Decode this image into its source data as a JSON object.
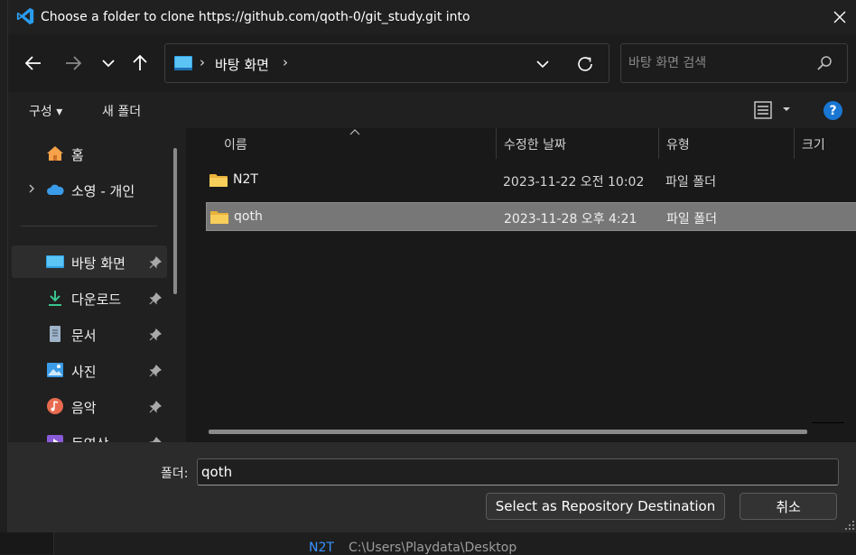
{
  "window": {
    "title": "Choose a folder to clone https://github.com/qoth-0/git_study.git into"
  },
  "nav": {
    "back_icon": "arrow-left-icon",
    "forward_icon": "arrow-right-icon",
    "recent_icon": "chevron-down-icon",
    "up_icon": "arrow-up-icon"
  },
  "address": {
    "separator": "›",
    "crumb": "바탕 화면",
    "crumb_separator": "›"
  },
  "search": {
    "placeholder": "바탕 화면 검색"
  },
  "commands": {
    "organize": "구성 ▾",
    "new_folder": "새 폴더",
    "help": "?"
  },
  "sidebar": {
    "items": [
      {
        "label": "홈",
        "icon": "home-icon",
        "pinned": false
      },
      {
        "label": "소영 - 개인",
        "icon": "onedrive-cloud-icon",
        "pinned": false,
        "expandable": true
      },
      {
        "label": "바탕 화면",
        "icon": "desktop-icon",
        "pinned": true,
        "selected": true
      },
      {
        "label": "다운로드",
        "icon": "download-icon",
        "pinned": true
      },
      {
        "label": "문서",
        "icon": "documents-icon",
        "pinned": true
      },
      {
        "label": "사진",
        "icon": "pictures-icon",
        "pinned": true
      },
      {
        "label": "음악",
        "icon": "music-icon",
        "pinned": true
      },
      {
        "label": "동영상",
        "icon": "videos-icon",
        "pinned": true
      }
    ]
  },
  "columns": {
    "name": "이름",
    "modified": "수정한 날짜",
    "type": "유형",
    "size": "크기"
  },
  "files": [
    {
      "name": "N2T",
      "modified": "2023-11-22 오전 10:02",
      "type": "파일 폴더",
      "selected": false
    },
    {
      "name": "qoth",
      "modified": "2023-11-28 오후 4:21",
      "type": "파일 폴더",
      "selected": true
    }
  ],
  "footer": {
    "folder_label": "폴더:",
    "folder_value": "qoth",
    "select_button": "Select as Repository Destination",
    "cancel_button": "취소"
  },
  "background": {
    "item": "N2T",
    "path": "C:\\Users\\Playdata\\Desktop"
  },
  "colors": {
    "accent": "#1976d2",
    "selection": "#777777",
    "folder": "#f3c544"
  }
}
